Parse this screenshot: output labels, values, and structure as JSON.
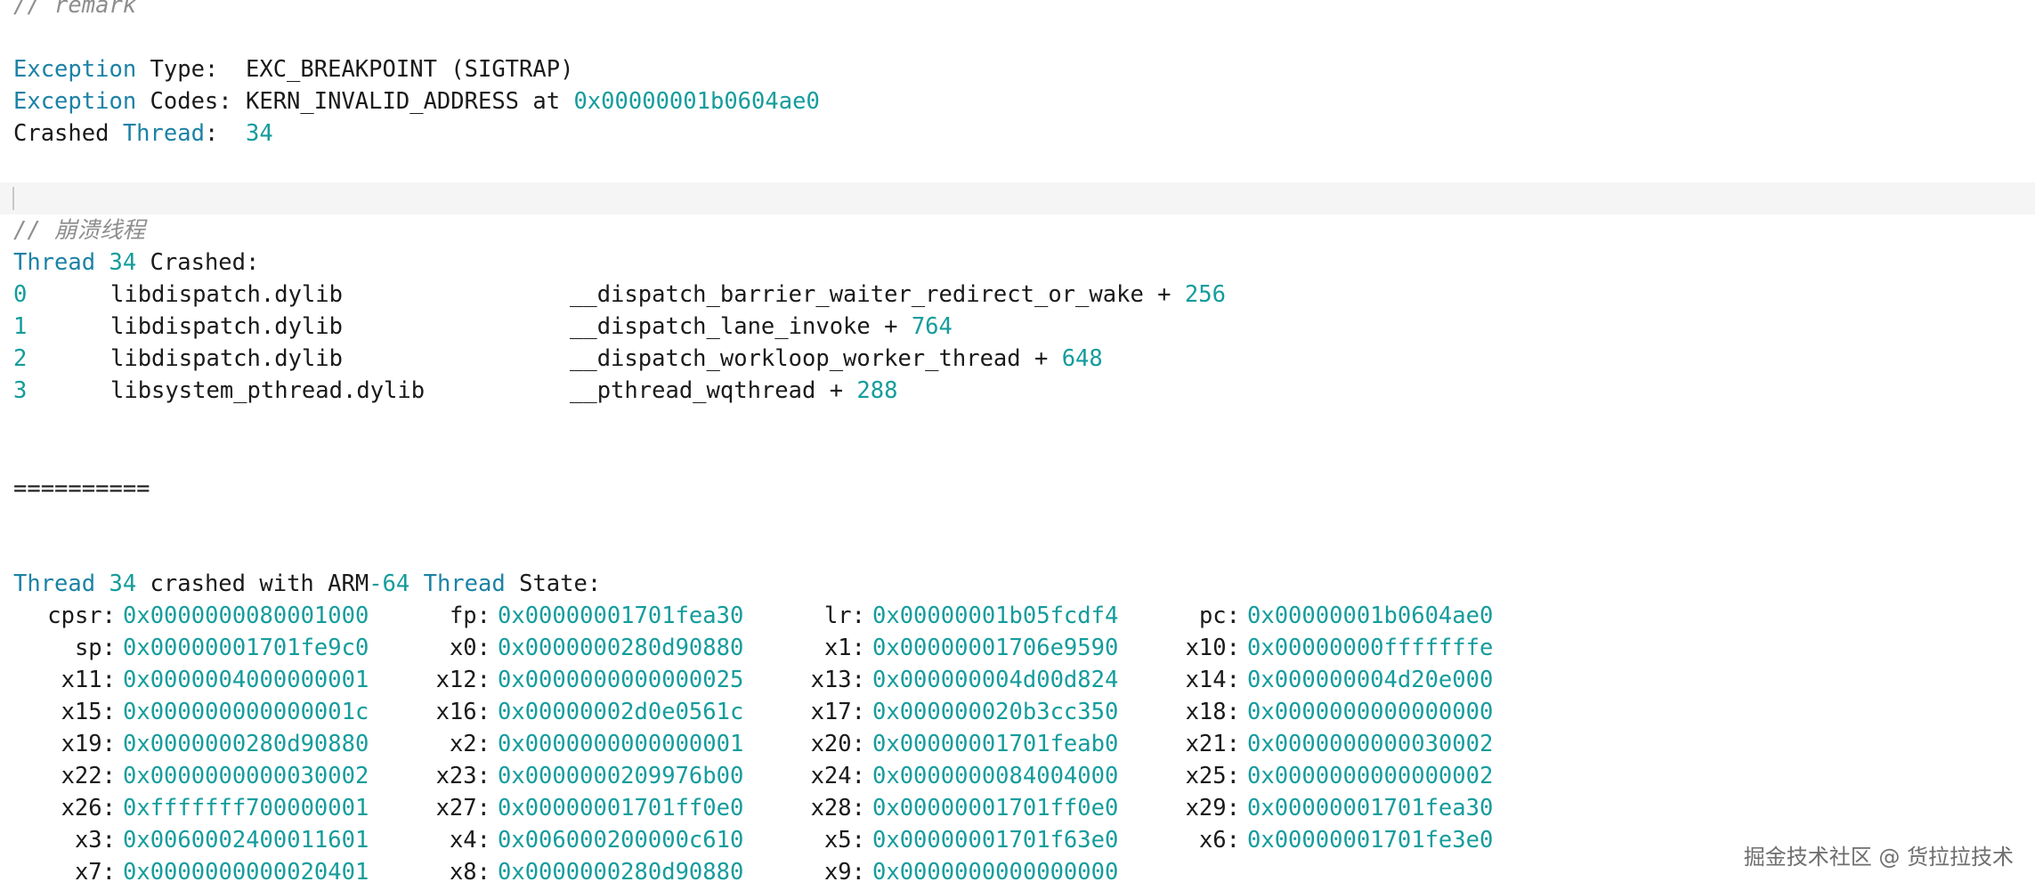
{
  "remark_comment": "// remark",
  "exception": {
    "type_kw": "Exception",
    "type_label": " Type:  EXC_BREAKPOINT (SIGTRAP)",
    "codes_kw": "Exception",
    "codes_label": " Codes: KERN_INVALID_ADDRESS at ",
    "codes_addr": "0x00000001b0604ae0",
    "crashed_label": "Crashed ",
    "crashed_kw": "Thread",
    "crashed_colon": ":  ",
    "crashed_num": "34"
  },
  "crash_comment": "// 崩溃线程",
  "thread_header": {
    "kw": "Thread",
    "num": " 34",
    "rest": " Crashed:"
  },
  "frames": [
    {
      "index": "0",
      "library": "libdispatch.dylib",
      "symbol": "__dispatch_barrier_waiter_redirect_or_wake + ",
      "offset": "256"
    },
    {
      "index": "1",
      "library": "libdispatch.dylib",
      "symbol": "__dispatch_lane_invoke + ",
      "offset": "764"
    },
    {
      "index": "2",
      "library": "libdispatch.dylib",
      "symbol": "__dispatch_workloop_worker_thread + ",
      "offset": "648"
    },
    {
      "index": "3",
      "library": "libsystem_pthread.dylib",
      "symbol": "__pthread_wqthread + ",
      "offset": "288"
    }
  ],
  "separator": "==========",
  "state_header": {
    "kw1": "Thread",
    "num1": " 34",
    "mid": " crashed with ARM",
    "num2": "-64",
    "sp": " ",
    "kw2": "Thread",
    "rest": " State:"
  },
  "registers": [
    [
      {
        "name": "cpsr:",
        "value": "0x0000000080001000"
      },
      {
        "name": "fp:",
        "value": "0x00000001701fea30"
      },
      {
        "name": "lr:",
        "value": "0x00000001b05fcdf4"
      },
      {
        "name": "pc:",
        "value": "0x00000001b0604ae0"
      }
    ],
    [
      {
        "name": "sp:",
        "value": "0x00000001701fe9c0"
      },
      {
        "name": "x0:",
        "value": "0x0000000280d90880"
      },
      {
        "name": "x1:",
        "value": "0x00000001706e9590"
      },
      {
        "name": "x10:",
        "value": "0x00000000fffffffe"
      }
    ],
    [
      {
        "name": "x11:",
        "value": "0x0000004000000001"
      },
      {
        "name": "x12:",
        "value": "0x0000000000000025"
      },
      {
        "name": "x13:",
        "value": "0x000000004d00d824"
      },
      {
        "name": "x14:",
        "value": "0x000000004d20e000"
      }
    ],
    [
      {
        "name": "x15:",
        "value": "0x000000000000001c"
      },
      {
        "name": "x16:",
        "value": "0x00000002d0e0561c"
      },
      {
        "name": "x17:",
        "value": "0x000000020b3cc350"
      },
      {
        "name": "x18:",
        "value": "0x0000000000000000"
      }
    ],
    [
      {
        "name": "x19:",
        "value": "0x0000000280d90880"
      },
      {
        "name": "x2:",
        "value": "0x0000000000000001"
      },
      {
        "name": "x20:",
        "value": "0x00000001701feab0"
      },
      {
        "name": "x21:",
        "value": "0x0000000000030002"
      }
    ],
    [
      {
        "name": "x22:",
        "value": "0x0000000000030002"
      },
      {
        "name": "x23:",
        "value": "0x0000000209976b00"
      },
      {
        "name": "x24:",
        "value": "0x0000000084004000"
      },
      {
        "name": "x25:",
        "value": "0x0000000000000002"
      }
    ],
    [
      {
        "name": "x26:",
        "value": "0xfffffff700000001"
      },
      {
        "name": "x27:",
        "value": "0x00000001701ff0e0"
      },
      {
        "name": "x28:",
        "value": "0x00000001701ff0e0"
      },
      {
        "name": "x29:",
        "value": "0x00000001701fea30"
      }
    ],
    [
      {
        "name": "x3:",
        "value": "0x0060002400011601"
      },
      {
        "name": "x4:",
        "value": "0x006000200000c610"
      },
      {
        "name": "x5:",
        "value": "0x00000001701f63e0"
      },
      {
        "name": "x6:",
        "value": "0x00000001701fe3e0"
      }
    ],
    [
      {
        "name": "x7:",
        "value": "0x0000000000020401"
      },
      {
        "name": "x8:",
        "value": "0x0000000280d90880"
      },
      {
        "name": "x9:",
        "value": "0x0000000000000000"
      }
    ]
  ],
  "watermark": "掘金技术社区 @ 货拉拉技术",
  "colors": {
    "keyword": "#1b82a6",
    "number": "#159c9c",
    "comment": "#8e8e8e",
    "text": "#1a1a1a",
    "active_line": "#f5f5f5"
  }
}
